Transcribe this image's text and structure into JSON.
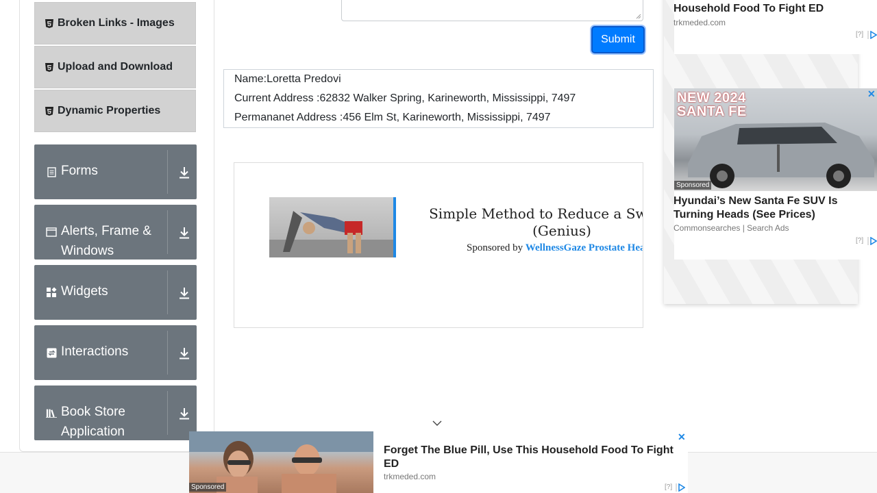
{
  "sidebar": {
    "sub_items": [
      {
        "label": "Broken Links - Images"
      },
      {
        "label": "Upload and Download"
      },
      {
        "label": "Dynamic Properties"
      }
    ],
    "groups": [
      {
        "label": "Forms",
        "icon": "forms-icon"
      },
      {
        "label": "Alerts, Frame & Windows",
        "icon": "window-icon"
      },
      {
        "label": "Widgets",
        "icon": "widgets-icon"
      },
      {
        "label": "Interactions",
        "icon": "interactions-icon"
      },
      {
        "label": "Book Store Application",
        "icon": "book-store-icon"
      }
    ]
  },
  "form": {
    "submit_label": "Submit"
  },
  "output": {
    "name": "Name:Loretta Predovi",
    "current_address": "Current Address :62832 Walker Spring, Karineworth, Mississippi, 7497",
    "permanent_address": "Permananet Address :456 Elm St, Karineworth, Mississippi, 7497"
  },
  "inline_ad": {
    "headline_line1": "Simple Method to Reduce a Swollen P",
    "headline_line2": "(Genius)",
    "sponsor_prefix": "Sponsored by",
    "sponsor_name": "WellnessGaze Prostate Health"
  },
  "right_ad": {
    "top_title": "Household Food To Fight ED",
    "top_source": "trkmeded.com",
    "q_mark": "[?]",
    "car_text_line1": "NEW 2024",
    "car_text_line2": "SANTA FE",
    "sponsored": "Sponsored",
    "bottom_title": "Hyundai’s New Santa Fe SUV Is Turning Heads (See Prices)",
    "bottom_source": "Commonsearches | Search Ads"
  },
  "bottom_ad": {
    "sponsored": "Sponsored",
    "title": "Forget The Blue Pill, Use This Household Food To Fight ED",
    "source": "trkmeded.com",
    "q_mark": "[?]"
  },
  "colors": {
    "primary": "#007bff",
    "sidebar_group_bg": "#6c757d",
    "sidebar_sub_bg": "#d2d2d2",
    "ad_link": "#1e88e5"
  }
}
